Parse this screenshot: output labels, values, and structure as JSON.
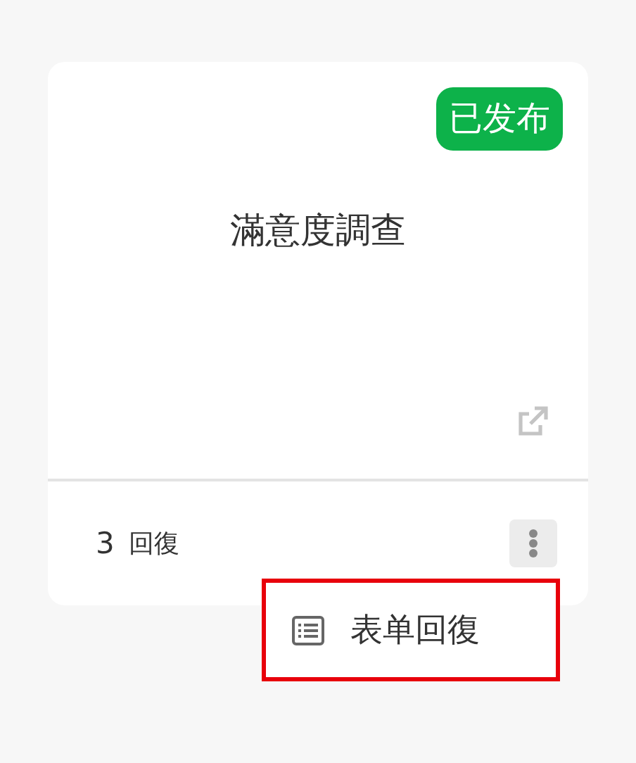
{
  "card": {
    "status": "已发布",
    "title": "滿意度調查",
    "response_count": "3",
    "response_label": "回復"
  },
  "menu": {
    "items": [
      {
        "label": "表单回復"
      }
    ]
  }
}
